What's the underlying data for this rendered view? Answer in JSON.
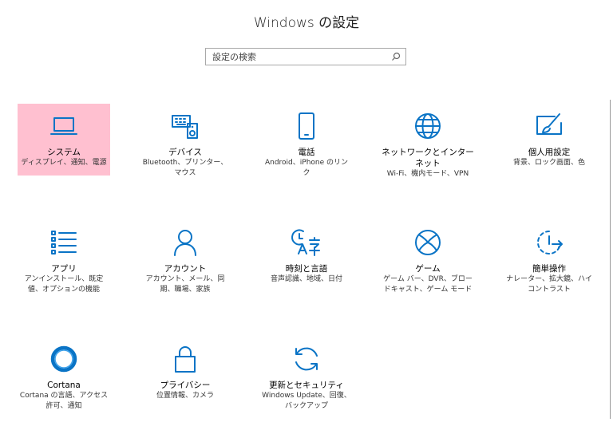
{
  "window": {
    "title": "Windows の設定"
  },
  "search": {
    "placeholder": "設定の検索",
    "icon": "search-icon"
  },
  "colors": {
    "accent": "#0a74c6",
    "selected": "#ffc0d0"
  },
  "tiles": [
    {
      "id": "system",
      "label": "システム",
      "desc": "ディスプレイ、通知、電源",
      "icon": "laptop-icon",
      "selected": true
    },
    {
      "id": "devices",
      "label": "デバイス",
      "desc": "Bluetooth、プリンター、マウス",
      "icon": "keyboard-speaker-icon"
    },
    {
      "id": "phone",
      "label": "電話",
      "desc": "Android、iPhone のリンク",
      "icon": "phone-icon"
    },
    {
      "id": "network",
      "label": "ネットワークとインターネット",
      "desc": "Wi-Fi、機内モード、VPN",
      "icon": "globe-icon"
    },
    {
      "id": "personalization",
      "label": "個人用設定",
      "desc": "背景、ロック画面、色",
      "icon": "paintbrush-icon"
    },
    {
      "id": "apps",
      "label": "アプリ",
      "desc": "アンインストール、既定値、オプションの機能",
      "icon": "app-list-icon"
    },
    {
      "id": "accounts",
      "label": "アカウント",
      "desc": "アカウント、メール、同期、職場、家族",
      "icon": "person-icon"
    },
    {
      "id": "time-language",
      "label": "時刻と言語",
      "desc": "音声認識、地域、日付",
      "icon": "clock-language-icon"
    },
    {
      "id": "gaming",
      "label": "ゲーム",
      "desc": "ゲーム バー、DVR、ブロードキャスト、ゲーム モード",
      "icon": "xbox-icon"
    },
    {
      "id": "ease-of-access",
      "label": "簡単操作",
      "desc": "ナレーター、拡大鏡、ハイコントラスト",
      "icon": "ease-of-access-icon"
    },
    {
      "id": "cortana",
      "label": "Cortana",
      "desc": "Cortana の言語、アクセス許可、通知",
      "icon": "cortana-circle-icon"
    },
    {
      "id": "privacy",
      "label": "プライバシー",
      "desc": "位置情報、カメラ",
      "icon": "lock-icon"
    },
    {
      "id": "update-security",
      "label": "更新とセキュリティ",
      "desc": "Windows Update、回復、バックアップ",
      "icon": "sync-arrows-icon"
    }
  ]
}
